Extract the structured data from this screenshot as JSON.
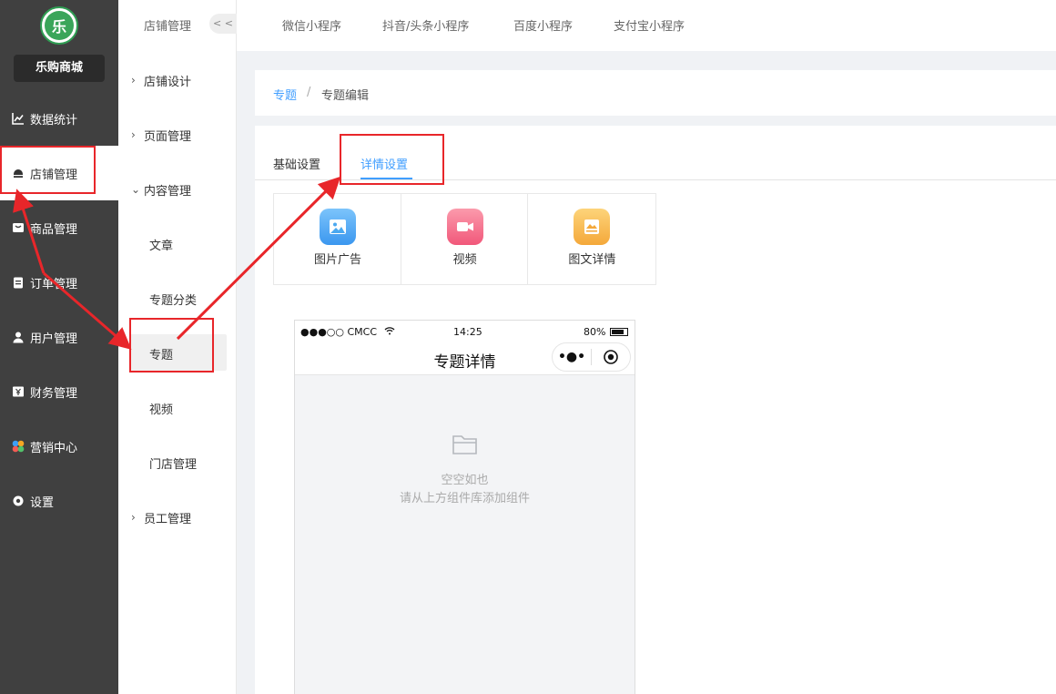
{
  "sidebar": {
    "logo_text": "乐",
    "shop_name": "乐购商城",
    "items": [
      {
        "label": "数据统计",
        "icon": "chart-line-icon"
      },
      {
        "label": "店铺管理",
        "icon": "store-icon"
      },
      {
        "label": "商品管理",
        "icon": "goods-icon"
      },
      {
        "label": "订单管理",
        "icon": "clipboard-icon"
      },
      {
        "label": "用户管理",
        "icon": "user-icon"
      },
      {
        "label": "财务管理",
        "icon": "yen-icon"
      },
      {
        "label": "营销中心",
        "icon": "marketing-icon"
      },
      {
        "label": "设置",
        "icon": "gear-icon"
      }
    ]
  },
  "submenu": {
    "title": "店铺管理",
    "collapse_label": "< <",
    "items": [
      {
        "label": "店铺设计"
      },
      {
        "label": "页面管理"
      },
      {
        "label": "内容管理"
      },
      {
        "label": "文章"
      },
      {
        "label": "专题分类"
      },
      {
        "label": "专题"
      },
      {
        "label": "视频"
      },
      {
        "label": "门店管理"
      },
      {
        "label": "员工管理"
      }
    ]
  },
  "topbar": {
    "tabs": [
      "微信小程序",
      "抖音/头条小程序",
      "百度小程序",
      "支付宝小程序"
    ]
  },
  "breadcrumb": {
    "link": "专题",
    "sep": "/",
    "current": "专题编辑"
  },
  "content_tabs": [
    "基础设置",
    "详情设置"
  ],
  "components": [
    {
      "label": "图片广告",
      "icon": "image-icon",
      "color": "#4aa8f0"
    },
    {
      "label": "视频",
      "icon": "video-icon",
      "color": "#f5738a"
    },
    {
      "label": "图文详情",
      "icon": "picture-text-icon",
      "color": "#f7b84b"
    }
  ],
  "phone": {
    "signal": "●●●○○ CMCC",
    "time": "14:25",
    "battery": "80%",
    "title": "专题详情",
    "capsule_more": "•●•",
    "empty_title": "空空如也",
    "empty_hint": "请从上方组件库添加组件"
  },
  "colors": {
    "sidebar_bg": "#404040",
    "accent": "#409eff",
    "annotation_red": "#e8262a"
  }
}
